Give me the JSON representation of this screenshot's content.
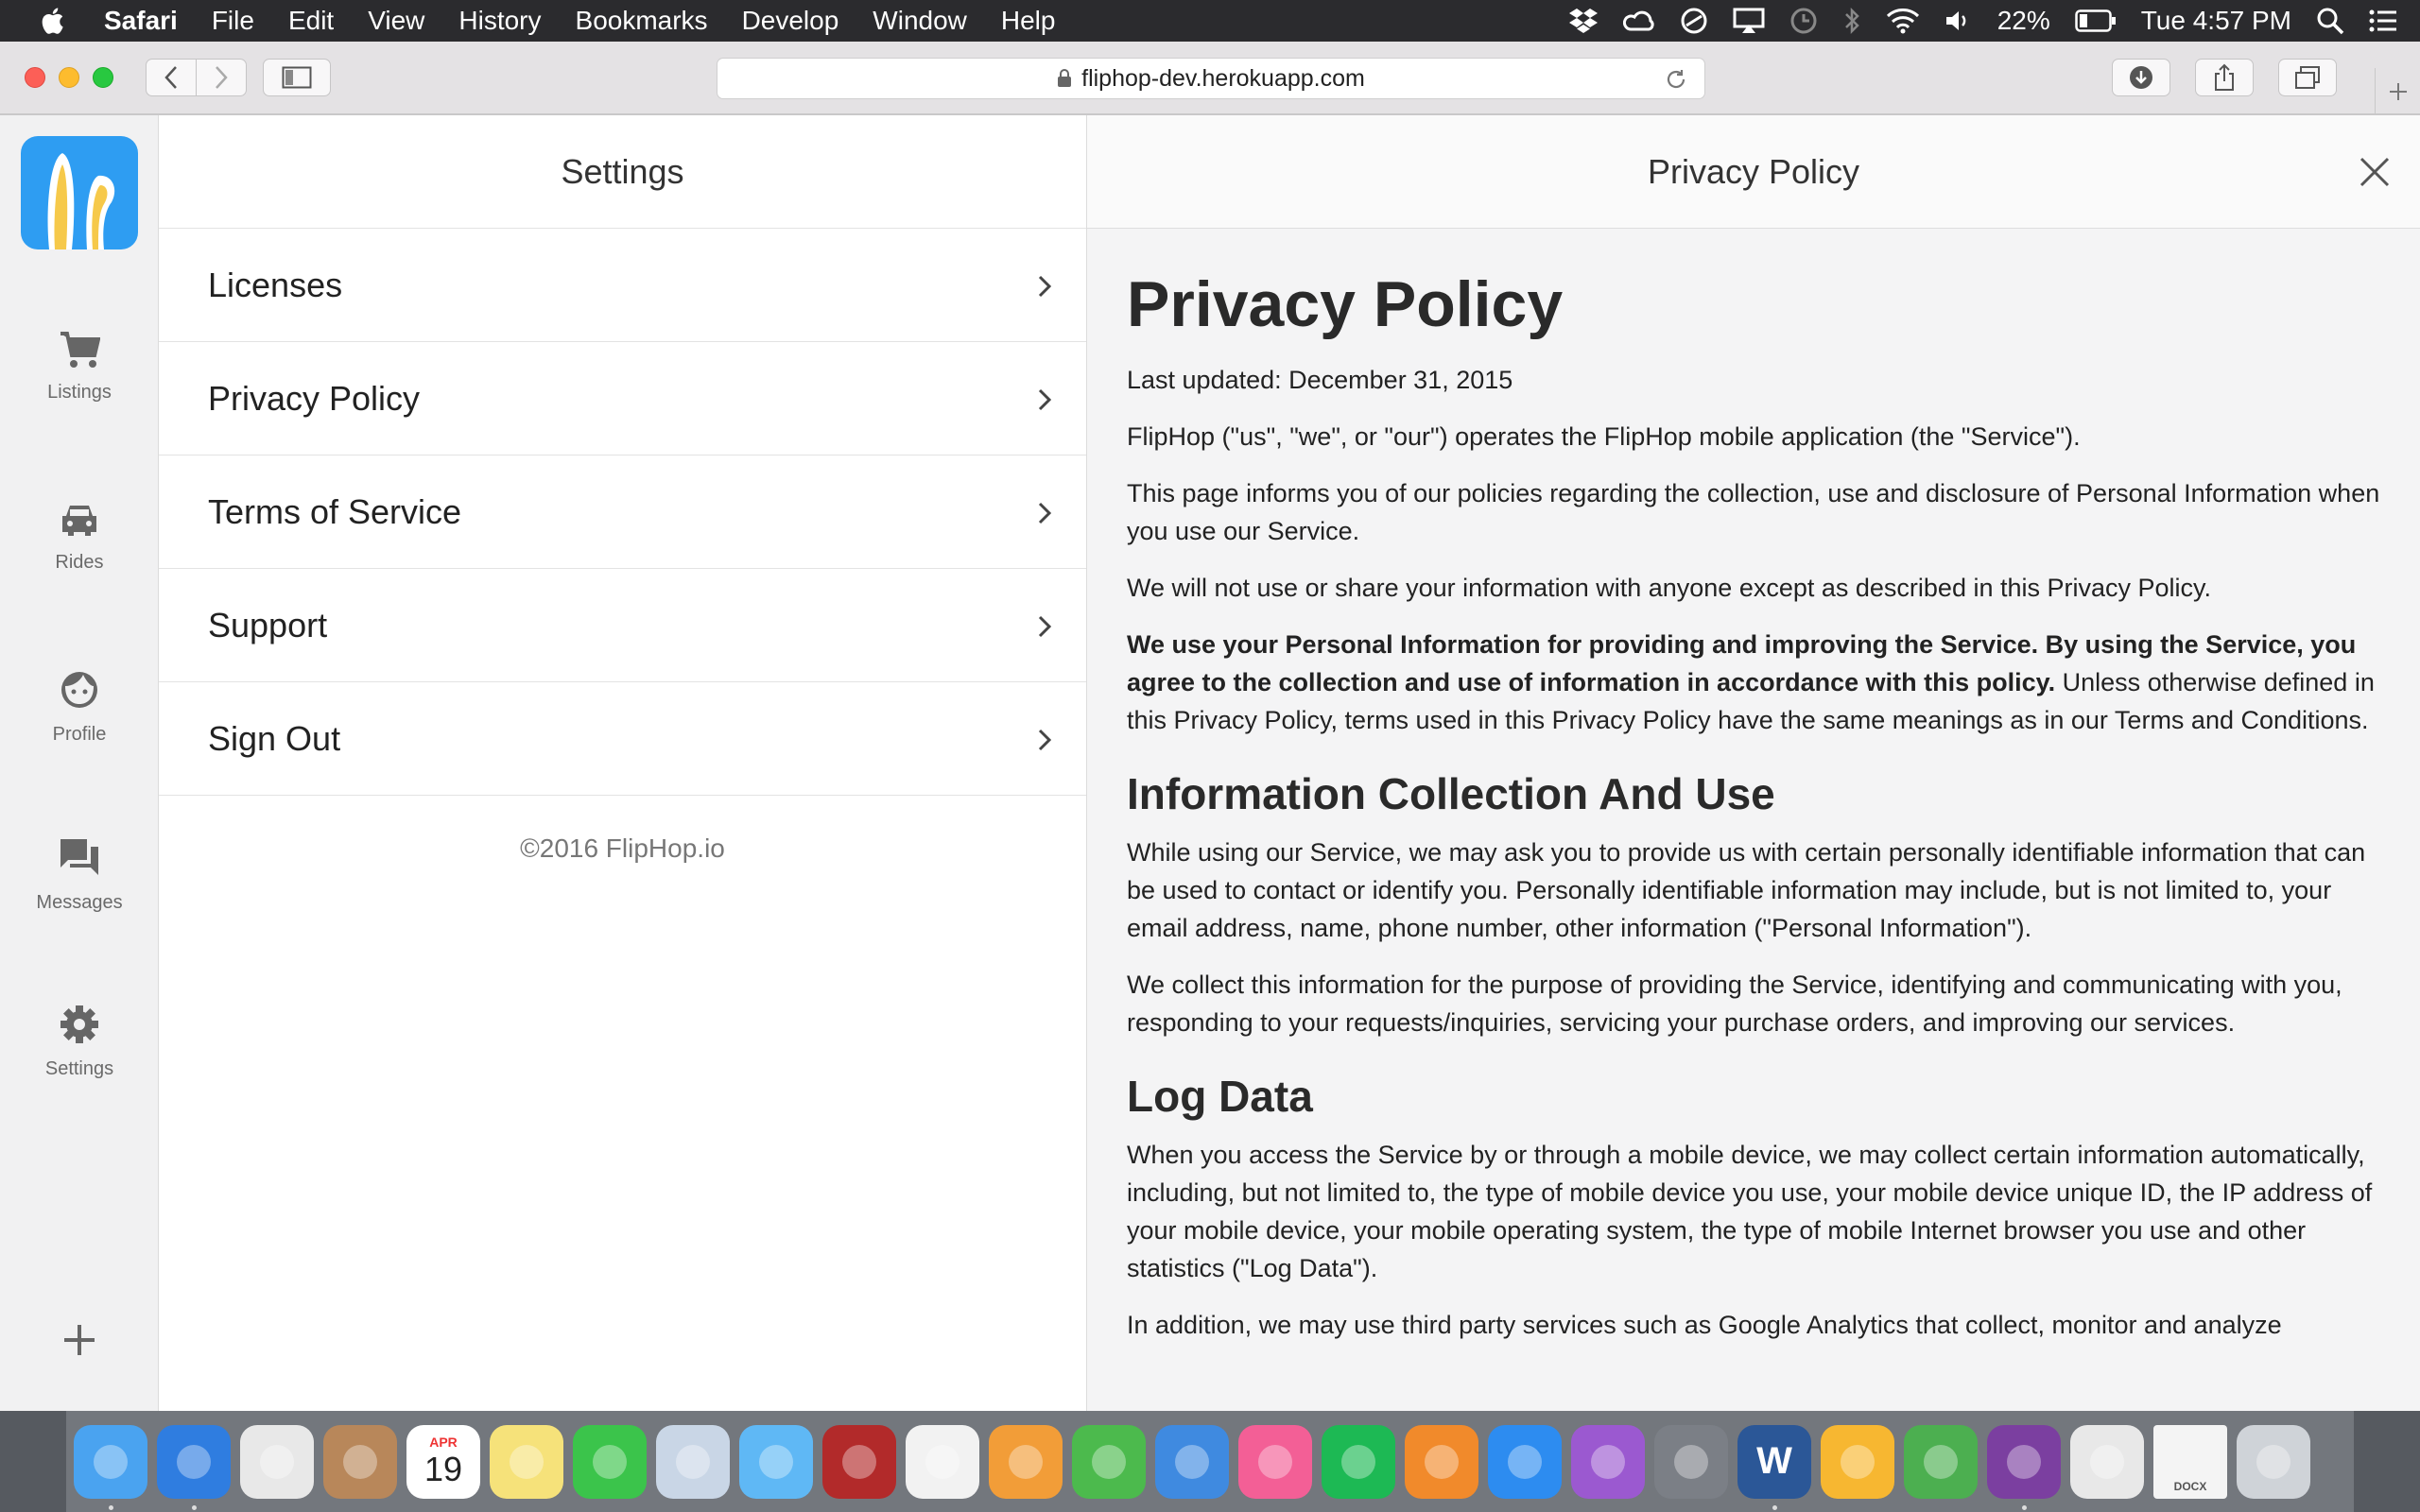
{
  "menubar": {
    "app_name": "Safari",
    "items": [
      "File",
      "Edit",
      "View",
      "History",
      "Bookmarks",
      "Develop",
      "Window",
      "Help"
    ],
    "battery": "22%",
    "clock": "Tue 4:57 PM"
  },
  "browser": {
    "url": "fliphop-dev.herokuapp.com"
  },
  "sidebar": {
    "items": [
      {
        "label": "Listings",
        "icon": "cart-icon"
      },
      {
        "label": "Rides",
        "icon": "car-icon"
      },
      {
        "label": "Profile",
        "icon": "face-icon"
      },
      {
        "label": "Messages",
        "icon": "chat-icon"
      },
      {
        "label": "Settings",
        "icon": "gear-icon"
      }
    ]
  },
  "settings": {
    "title": "Settings",
    "rows": [
      "Licenses",
      "Privacy Policy",
      "Terms of Service",
      "Support",
      "Sign Out"
    ],
    "copyright": "©2016 FlipHop.io"
  },
  "policy": {
    "header_title": "Privacy Policy",
    "heading": "Privacy Policy",
    "last_updated": "Last updated: December 31, 2015",
    "p1": "FlipHop (\"us\", \"we\", or \"our\") operates the FlipHop mobile application (the \"Service\").",
    "p2": "This page informs you of our policies regarding the collection, use and disclosure of Personal Information when you use our Service.",
    "p3": "We will not use or share your information with anyone except as described in this Privacy Policy.",
    "p4_bold": "We use your Personal Information for providing and improving the Service. By using the Service, you agree to the collection and use of information in accordance with this policy.",
    "p4_rest": " Unless otherwise defined in this Privacy Policy, terms used in this Privacy Policy have the same meanings as in our Terms and Conditions.",
    "h_collection": "Information Collection And Use",
    "p5": "While using our Service, we may ask you to provide us with certain personally identifiable information that can be used to contact or identify you. Personally identifiable information may include, but is not limited to, your email address, name, phone number, other information (\"Personal Information\").",
    "p6": "We collect this information for the purpose of providing the Service, identifying and communicating with you, responding to your requests/inquiries, servicing your purchase orders, and improving our services.",
    "h_log": "Log Data",
    "p7": "When you access the Service by or through a mobile device, we may collect certain information automatically, including, but not limited to, the type of mobile device you use, your mobile device unique ID, the IP address of your mobile device, your mobile operating system, the type of mobile Internet browser you use and other statistics (\"Log Data\").",
    "p8": "In addition, we may use third party services such as Google Analytics that collect, monitor and analyze"
  },
  "dock": {
    "apps": [
      {
        "name": "finder-icon",
        "color": "#4aa3f0"
      },
      {
        "name": "safari-icon",
        "color": "#2f7de0"
      },
      {
        "name": "chrome-icon",
        "color": "#e8e8e8"
      },
      {
        "name": "contacts-icon",
        "color": "#b8875a"
      },
      {
        "name": "calendar-icon",
        "color": "#ffffff"
      },
      {
        "name": "notes-icon",
        "color": "#f6e27a"
      },
      {
        "name": "facetime-icon",
        "color": "#3bc44b"
      },
      {
        "name": "preview-icon",
        "color": "#c9d6e6"
      },
      {
        "name": "messages-icon",
        "color": "#5fb8f5"
      },
      {
        "name": "photobooth-icon",
        "color": "#b22a2a"
      },
      {
        "name": "photos-icon",
        "color": "#f2f2f2"
      },
      {
        "name": "pages-icon",
        "color": "#f29d38"
      },
      {
        "name": "numbers-icon",
        "color": "#4cba4d"
      },
      {
        "name": "keynote-icon",
        "color": "#3f8ae0"
      },
      {
        "name": "itunes-icon",
        "color": "#f35f96"
      },
      {
        "name": "spotify-icon",
        "color": "#1db954"
      },
      {
        "name": "ibooks-icon",
        "color": "#f18a2b"
      },
      {
        "name": "appstore-icon",
        "color": "#2d8cf0"
      },
      {
        "name": "feedback-icon",
        "color": "#9b59d0"
      },
      {
        "name": "system-preferences-icon",
        "color": "#7b7f86"
      },
      {
        "name": "word-icon",
        "color": "#2b5797"
      },
      {
        "name": "sketch-icon",
        "color": "#f7b731"
      },
      {
        "name": "leaf-icon",
        "color": "#4caf50"
      },
      {
        "name": "github-icon",
        "color": "#7b3fa0"
      },
      {
        "name": "slack-icon",
        "color": "#e8e8e8"
      },
      {
        "name": "docx-file-icon",
        "color": "#f4f4f4"
      },
      {
        "name": "trash-icon",
        "color": "#cfd3d8"
      }
    ],
    "calendar_month": "APR",
    "calendar_day": "19",
    "word_letter": "W",
    "docx_label": "DOCX"
  }
}
